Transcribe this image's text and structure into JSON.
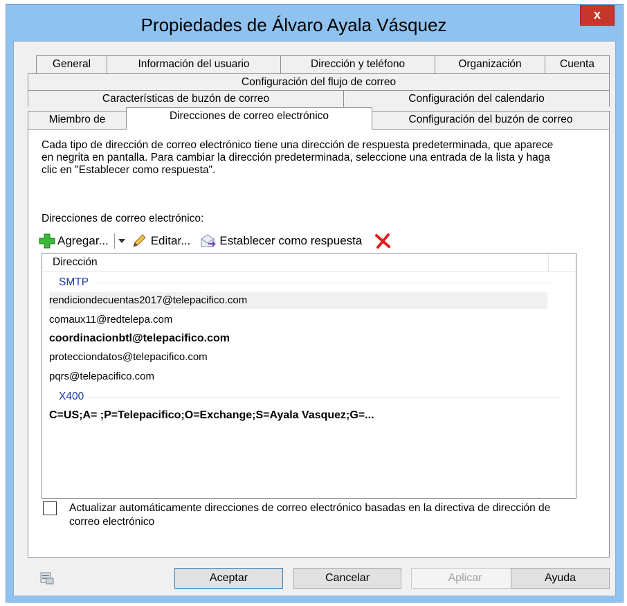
{
  "window": {
    "title": "Propiedades de Álvaro Ayala Vásquez",
    "close_glyph": "x"
  },
  "tabs": {
    "row1": [
      "General",
      "Información del usuario",
      "Dirección y teléfono",
      "Organización",
      "Cuenta"
    ],
    "row2": [
      "Configuración del flujo de correo"
    ],
    "row3": [
      "Características de buzón de correo",
      "Configuración del calendario"
    ],
    "row4": [
      "Miembro de",
      "Direcciones de correo electrónico",
      "Configuración del buzón de correo"
    ],
    "active": "Direcciones de correo electrónico"
  },
  "panel": {
    "description": "Cada tipo de dirección de correo electrónico tiene una dirección de respuesta predeterminada, que aparece en negrita en pantalla. Para cambiar la dirección predeterminada, seleccione una entrada de la lista y haga clic en \"Establecer como respuesta\".",
    "list_label": "Direcciones de correo electrónico:"
  },
  "toolbar": {
    "add_label": "Agregar...",
    "edit_label": "Editar...",
    "set_reply_label": "Establecer como respuesta"
  },
  "address_list": {
    "column_header": "Dirección",
    "groups": [
      {
        "name": "SMTP",
        "rows": [
          {
            "text": "rendiciondecuentas2017@telepacifico.com",
            "bold": false,
            "hover": true
          },
          {
            "text": "comaux11@redtelepa.com",
            "bold": false,
            "hover": false
          },
          {
            "text": "coordinacionbtl@telepacifico.com",
            "bold": true,
            "hover": false
          },
          {
            "text": "protecciondatos@telepacifico.com",
            "bold": false,
            "hover": false
          },
          {
            "text": "pqrs@telepacifico.com",
            "bold": false,
            "hover": false
          }
        ]
      },
      {
        "name": "X400",
        "rows": [
          {
            "text": "C=US;A= ;P=Telepacifico;O=Exchange;S=Ayala Vasquez;G=...",
            "bold": true,
            "hover": false
          }
        ]
      }
    ]
  },
  "auto_update": {
    "label": "Actualizar automáticamente direcciones de correo electrónico basadas en la directiva de dirección de correo electrónico",
    "checked": false
  },
  "buttons": {
    "ok": "Aceptar",
    "cancel": "Cancelar",
    "apply": "Aplicar",
    "help": "Ayuda"
  },
  "colors": {
    "title_bar": "#8fc2ee",
    "close": "#c7362b",
    "group_header": "#1e3aad",
    "add_icon": "#3cb83a",
    "delete_icon": "#e02020"
  }
}
